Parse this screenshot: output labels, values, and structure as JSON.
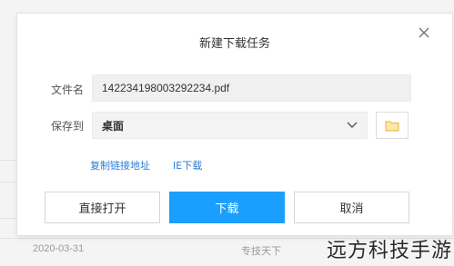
{
  "dialog": {
    "title": "新建下载任务",
    "close_icon": "close-icon",
    "filename_label": "文件名",
    "filename_value": "142234198003292234.pdf",
    "saveto_label": "保存到",
    "saveto_value": "桌面",
    "links": {
      "copy_link": "复制链接地址",
      "ie_download": "IE下载"
    },
    "buttons": {
      "open_direct": "直接打开",
      "download": "下载",
      "cancel": "取消"
    },
    "colors": {
      "primary": "#1a9fff",
      "link": "#2b7dd6",
      "folder": "#e8b339"
    }
  },
  "background": {
    "date": "2020-03-31",
    "tag": "专技天下",
    "edge_char": "专"
  },
  "watermark": "远方科技手游"
}
